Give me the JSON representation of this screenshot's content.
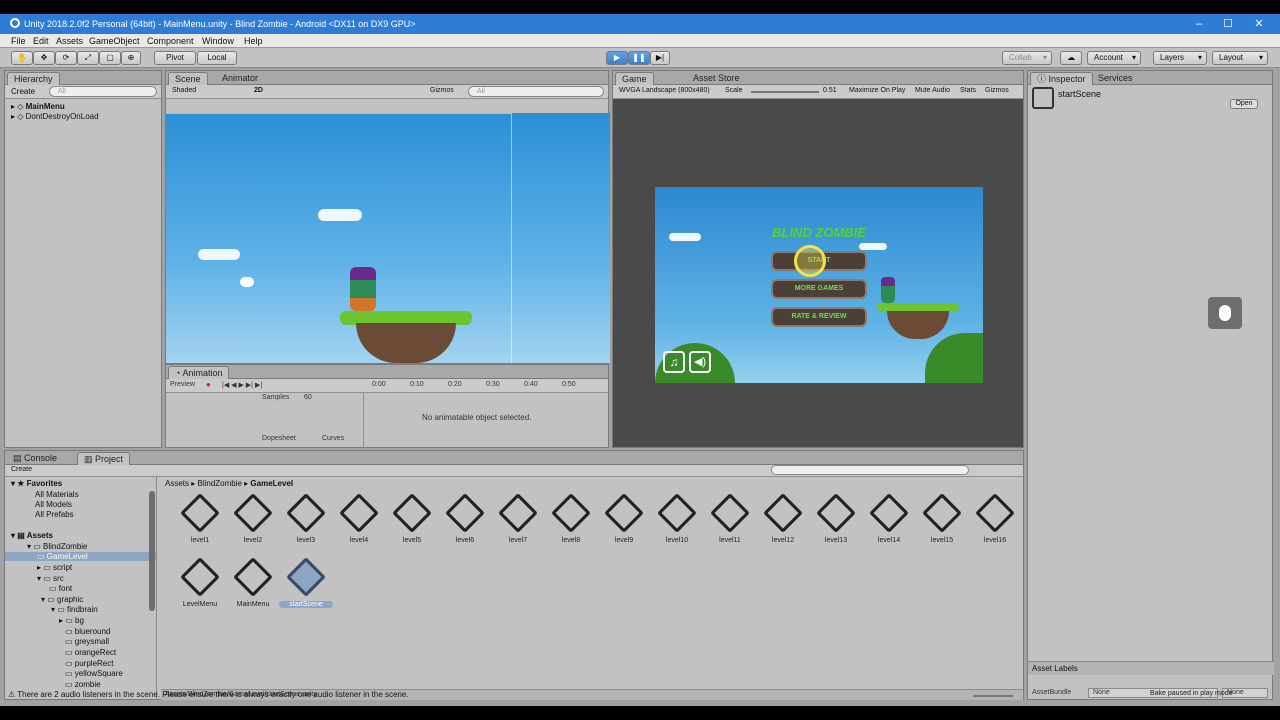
{
  "window": {
    "title": "Unity 2018.2.0f2 Personal (64bit) - MainMenu.unity - Blind Zombie - Android <DX11 on DX9 GPU>"
  },
  "menu": [
    "File",
    "Edit",
    "Assets",
    "GameObject",
    "Component",
    "Window",
    "Help"
  ],
  "toolbar": {
    "pivot": "Pivot",
    "local": "Local",
    "collab": "Collab",
    "account": "Account",
    "layers": "Layers",
    "layout": "Layout"
  },
  "hierarchy": {
    "tab": "Hierarchy",
    "create": "Create",
    "search": "All",
    "items": [
      "MainMenu",
      "DontDestroyOnLoad"
    ]
  },
  "scene": {
    "tabs": [
      "Scene",
      "Animator"
    ],
    "shading": "Shaded",
    "mode2d": "2D",
    "gizmos": "Gizmos",
    "search": "All"
  },
  "game": {
    "tabs": [
      "Game",
      "Asset Store"
    ],
    "resolution": "WVGA Landscape (800x480)",
    "scale_label": "Scale",
    "scale_value": "0.51",
    "maximize": "Maximize On Play",
    "mute": "Mute Audio",
    "stats": "Stats",
    "gizmos": "Gizmos",
    "title": "BLIND ZOMBIE",
    "buttons": [
      "START",
      "MORE GAMES",
      "RATE & REVIEW"
    ]
  },
  "animation": {
    "tab": "Animation",
    "preview": "Preview",
    "samples_label": "Samples",
    "samples_value": "60",
    "ticks": [
      "0:00",
      "0:10",
      "0:20",
      "0:30",
      "0:40",
      "0:50"
    ],
    "empty": "No animatable object selected.",
    "dopesheet": "Dopesheet",
    "curves": "Curves"
  },
  "inspector": {
    "tabs": [
      "Inspector",
      "Services"
    ],
    "object": "startScene",
    "open": "Open",
    "asset_labels": "Asset Labels",
    "asset_bundle": "AssetBundle",
    "none1": "None",
    "none2": "None",
    "status": "Bake paused in play mode"
  },
  "project": {
    "tabs": [
      "Console",
      "Project"
    ],
    "create": "Create",
    "favorites": "Favorites",
    "fav_items": [
      "All Materials",
      "All Models",
      "All Prefabs"
    ],
    "assets": "Assets",
    "tree": [
      "BlindZombie",
      "GameLevel",
      "script",
      "src",
      "font",
      "graphic",
      "findbrain",
      "bg",
      "blueround",
      "greysmall",
      "orangeRect",
      "purpleRect",
      "yellowSquare",
      "zombie"
    ],
    "breadcrumb": [
      "Assets",
      "BlindZombie",
      "GameLevel"
    ],
    "files": [
      "level1",
      "level2",
      "level3",
      "level4",
      "level5",
      "level6",
      "level7",
      "level8",
      "level9",
      "level10",
      "level11",
      "level12",
      "level13",
      "level14",
      "level15",
      "level16",
      "LevelMenu",
      "MainMenu",
      "startScene"
    ],
    "path": "Assets/BlindZombie/GameLevel/startScene.unity"
  },
  "console_warning": "There are 2 audio listeners in the scene. Please ensure there is always exactly one audio listener in the scene."
}
